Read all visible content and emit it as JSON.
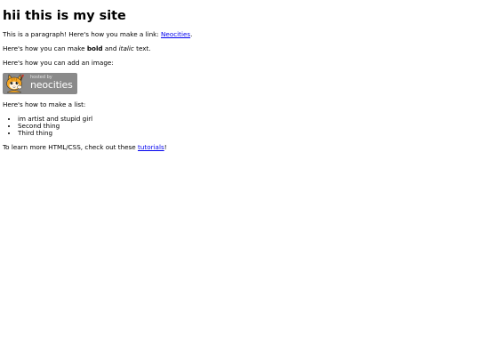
{
  "heading": "hii this is my site",
  "para1": {
    "text_before": "This is a paragraph! Here's how you make a link: ",
    "link_text": "Neocities",
    "text_after": "."
  },
  "para2": {
    "before": "Here's how you can make ",
    "bold": "bold",
    "middle": " and ",
    "italic": "italic",
    "after": " text."
  },
  "para3": "Here's how you can add an image:",
  "badge": {
    "small_text": "hosted by",
    "big_text": "neocities"
  },
  "para4": "Here's how to make a list:",
  "list_items": [
    "im artist and stupid girl",
    "Second thing",
    "Third thing"
  ],
  "para5": {
    "before": "To learn more HTML/CSS, check out these ",
    "link_text": "tutorials",
    "after": "!"
  }
}
